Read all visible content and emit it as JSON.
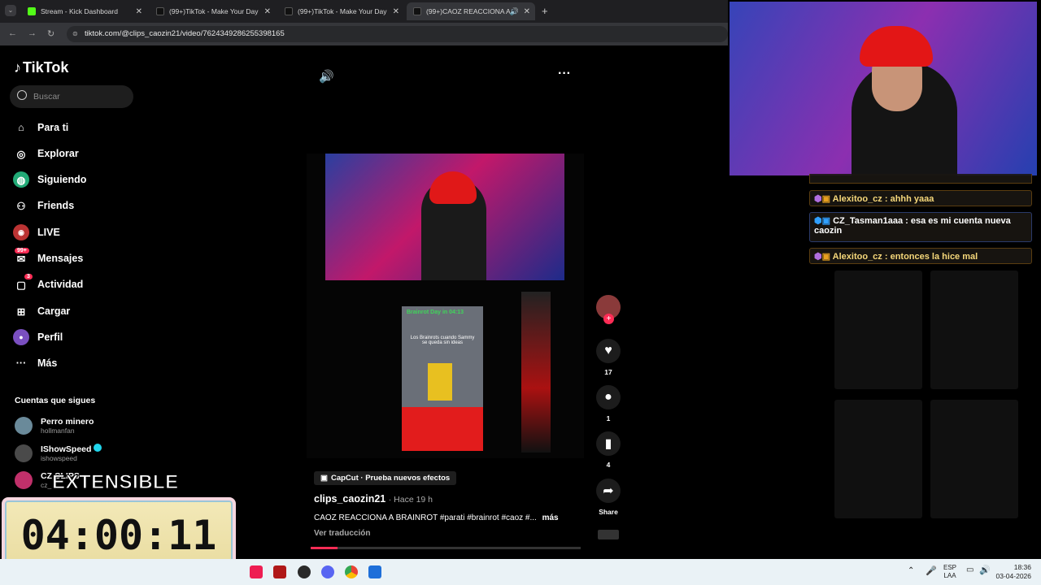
{
  "browser": {
    "tabs": [
      {
        "title": "Stream - Kick Dashboard",
        "color": "#53fc18"
      },
      {
        "title": "(99+)TikTok - Make Your Day",
        "color": "#ffffff"
      },
      {
        "title": "(99+)TikTok - Make Your Day",
        "color": "#ffffff"
      },
      {
        "title": "(99+)CAOZ REACCIONA A",
        "color": "#ffffff"
      }
    ],
    "url": "tiktok.com/@clips_caozin21/video/7624349286255398165"
  },
  "tiktok": {
    "logo": "TikTok",
    "search_placeholder": "Buscar",
    "nav": [
      {
        "label": "Para ti",
        "icon": "home-icon"
      },
      {
        "label": "Explorar",
        "icon": "compass-icon"
      },
      {
        "label": "Siguiendo",
        "icon": "following-icon"
      },
      {
        "label": "Friends",
        "icon": "friends-icon"
      },
      {
        "label": "LIVE",
        "icon": "live-icon"
      },
      {
        "label": "Mensajes",
        "icon": "messages-icon",
        "badge": "99+"
      },
      {
        "label": "Actividad",
        "icon": "activity-icon",
        "badge": "3"
      },
      {
        "label": "Cargar",
        "icon": "upload-icon"
      },
      {
        "label": "Perfil",
        "icon": "profile-icon"
      },
      {
        "label": "Más",
        "icon": "more-icon"
      }
    ],
    "following_title": "Cuentas que sigues",
    "following": [
      {
        "name": "Perro minero",
        "handle": "hollmanfan"
      },
      {
        "name": "IShowSpeed",
        "handle": "ishowspeed"
      },
      {
        "name": "CZ CLIPS",
        "handle": "cz_"
      }
    ],
    "video": {
      "capcut": "CapCut · Prueba nuevos efectos",
      "author": "clips_caozin21",
      "time": "· Hace 19 h",
      "caption": "CAOZ REACCIONA A BRAINROT #parati #brainrot #caoz #...",
      "more": "más",
      "translate": "Ver traducción",
      "inner_text": "Los Brainrots cuando Sammy se queda sin ideas",
      "inner_banner": "Brainrot Day in 04:13",
      "progress": 0.1
    },
    "actions": {
      "likes": "17",
      "comments": "1",
      "saves": "4",
      "share": "Share"
    }
  },
  "overlay": {
    "extensible": "EXTENSIBLE",
    "timer": "04:00:11"
  },
  "chat": [
    {
      "user": "Alexitoo_cz",
      "text": " : ahhh yaaa",
      "color": "#f5d77a"
    },
    {
      "user": "CZ_Tasman1aaa",
      "text": " : esa es mi cuenta nueva caozin",
      "color": "#ffffff"
    },
    {
      "user": "Alexitoo_cz",
      "text": " : entonces la hice mal",
      "color": "#f5d77a"
    }
  ],
  "taskbar": {
    "lang": "ESP",
    "lang2": "LAA",
    "time": "18:36",
    "date": "03-04-2026"
  }
}
